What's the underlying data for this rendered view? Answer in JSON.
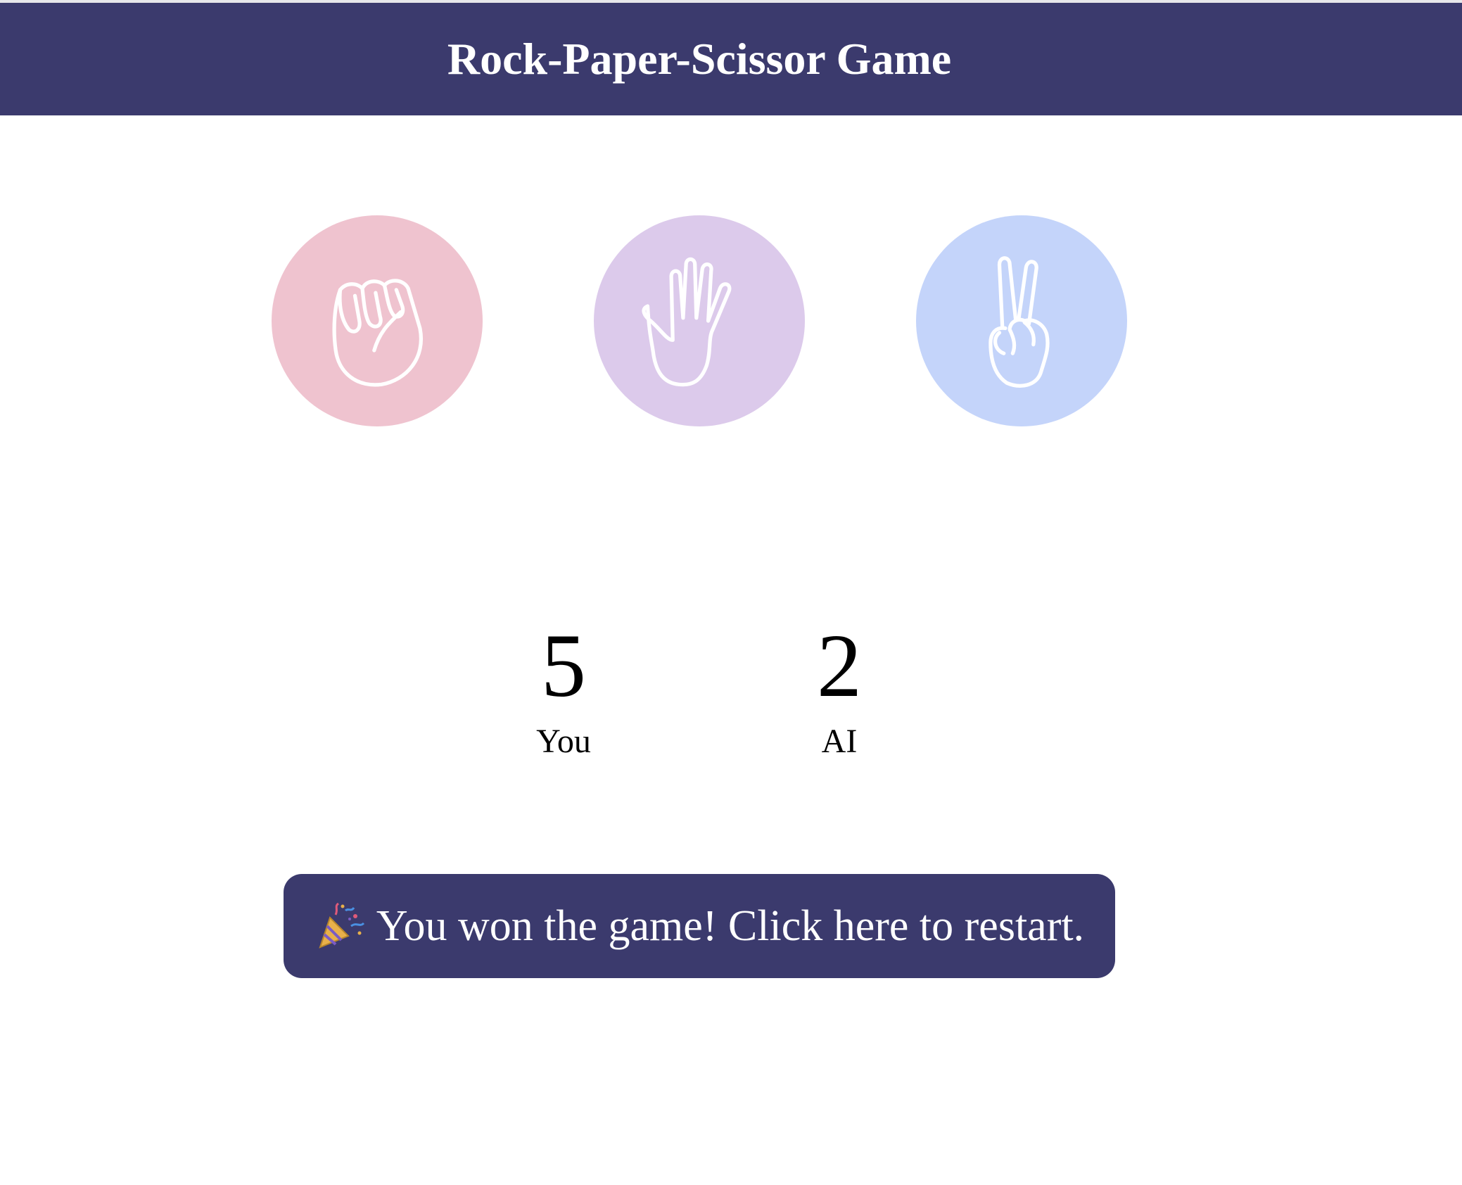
{
  "header": {
    "title": "Rock-Paper-Scissor Game",
    "background": "#3b3a6d"
  },
  "choices": [
    {
      "name": "rock",
      "icon": "fist-icon",
      "color": "#efc3cf"
    },
    {
      "name": "paper",
      "icon": "open-hand-icon",
      "color": "#dccaeb"
    },
    {
      "name": "scissors",
      "icon": "peace-hand-icon",
      "color": "#c4d4fa"
    }
  ],
  "score": {
    "you": {
      "value": "5",
      "label": "You"
    },
    "ai": {
      "value": "2",
      "label": "AI"
    }
  },
  "restart": {
    "icon": "party-popper-icon",
    "label": "You won the game! Click here to restart."
  }
}
